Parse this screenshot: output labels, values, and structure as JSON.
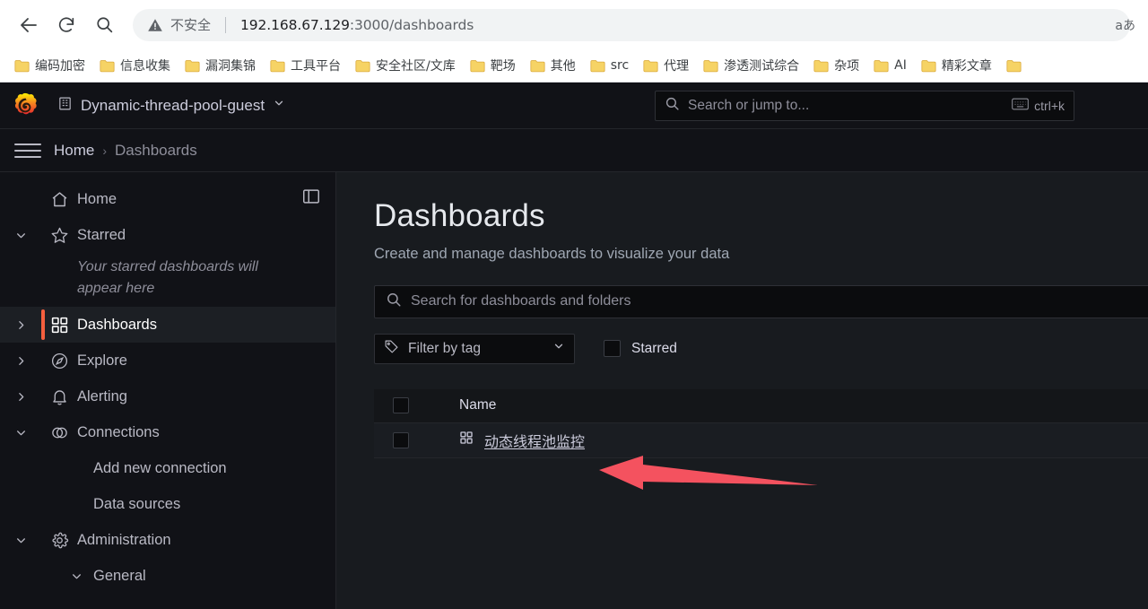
{
  "browser": {
    "nav_icons": [
      {
        "name": "back-button",
        "icon": "arrow-left-icon"
      },
      {
        "name": "reload-button",
        "icon": "reload-icon"
      },
      {
        "name": "search-button",
        "icon": "search-icon"
      }
    ],
    "security_label": "不安全",
    "url_host": "192.168.67.129",
    "url_path": ":3000/dashboards",
    "url_full": "192.168.67.129:3000/dashboards",
    "translate_icon_label": "aあ",
    "bookmarks": [
      {
        "label": "编码加密"
      },
      {
        "label": "信息收集"
      },
      {
        "label": "漏洞集锦"
      },
      {
        "label": "工具平台"
      },
      {
        "label": "安全社区/文库"
      },
      {
        "label": "靶场"
      },
      {
        "label": "其他"
      },
      {
        "label": "src"
      },
      {
        "label": "代理"
      },
      {
        "label": "渗透测试综合"
      },
      {
        "label": "杂项"
      },
      {
        "label": "AI"
      },
      {
        "label": "精彩文章"
      },
      {
        "label": ""
      }
    ]
  },
  "topnav": {
    "logo_name": "grafana-logo",
    "org_name": "Dynamic-thread-pool-guest",
    "search_placeholder": "Search or jump to...",
    "search_shortcut": "ctrl+k"
  },
  "breadcrumb": {
    "items": [
      {
        "label": "Home",
        "current": false
      },
      {
        "label": "Dashboards",
        "current": true
      }
    ],
    "separator": "›"
  },
  "sidebar": {
    "items": [
      {
        "label": "Home",
        "icon": "home-icon",
        "chevron": "none",
        "active": false,
        "sub": false
      },
      {
        "label": "Starred",
        "icon": "star-icon",
        "chevron": "down",
        "active": false,
        "sub": false
      },
      {
        "label": "Dashboards",
        "icon": "dashboards-grid-icon",
        "chevron": "right",
        "active": true,
        "sub": false
      },
      {
        "label": "Explore",
        "icon": "compass-icon",
        "chevron": "right",
        "active": false,
        "sub": false
      },
      {
        "label": "Alerting",
        "icon": "bell-icon",
        "chevron": "right",
        "active": false,
        "sub": false
      },
      {
        "label": "Connections",
        "icon": "connections-icon",
        "chevron": "down",
        "active": false,
        "sub": false
      },
      {
        "label": "Add new connection",
        "icon": "none",
        "chevron": "none",
        "active": false,
        "sub": true
      },
      {
        "label": "Data sources",
        "icon": "none",
        "chevron": "none",
        "active": false,
        "sub": true
      },
      {
        "label": "Administration",
        "icon": "gear-icon",
        "chevron": "down",
        "active": false,
        "sub": false
      },
      {
        "label": "General",
        "icon": "none",
        "chevron": "down",
        "active": false,
        "sub": true
      }
    ],
    "starred_empty_text": "Your starred dashboards will appear here",
    "dock_button_name": "dock-menu-button",
    "active_accent_color": "#f55f3e"
  },
  "main": {
    "title": "Dashboards",
    "subtitle": "Create and manage dashboards to visualize your data",
    "search_placeholder": "Search for dashboards and folders",
    "tag_filter_label": "Filter by tag",
    "starred_label": "Starred",
    "table": {
      "columns": [
        "Name"
      ],
      "rows": [
        {
          "name": "动态线程池监控",
          "icon": "dashboard-grid-icon"
        }
      ]
    }
  },
  "annotation": {
    "arrow_color": "#f4525f",
    "arrow_name": "red-pointer-arrow"
  }
}
